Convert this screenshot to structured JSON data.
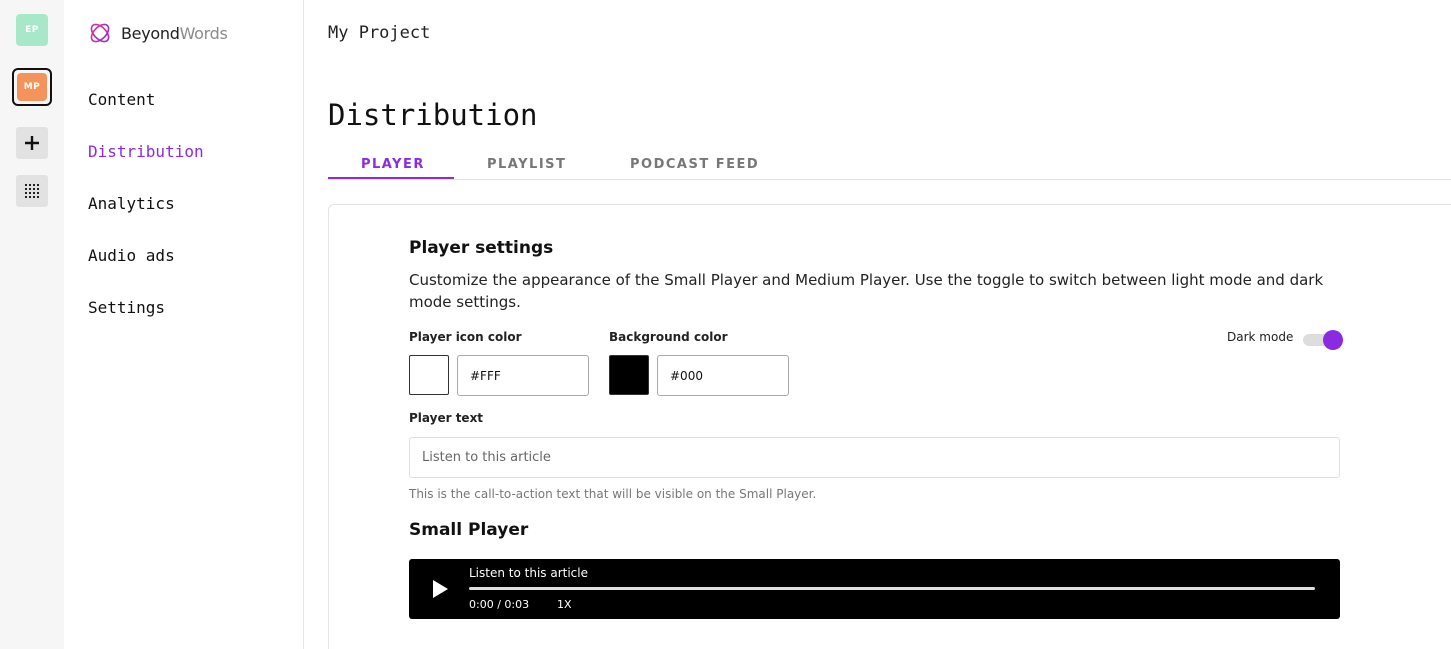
{
  "rail": {
    "workspaces": [
      {
        "initials": "EP",
        "color": "#a8e8c8"
      },
      {
        "initials": "MP",
        "color": "#f4935a",
        "selected": true
      }
    ],
    "add_icon": "plus-icon",
    "apps_icon": "grid-icon"
  },
  "brand": {
    "name_bold": "Beyond",
    "name_light": "Words",
    "logo_icon": "beyondwords-logo-icon"
  },
  "sidebar": {
    "items": [
      {
        "label": "Content"
      },
      {
        "label": "Distribution",
        "active": true
      },
      {
        "label": "Analytics"
      },
      {
        "label": "Audio ads"
      },
      {
        "label": "Settings"
      }
    ]
  },
  "header": {
    "project": "My Project",
    "title": "Distribution"
  },
  "tabs": [
    {
      "label": "PLAYER",
      "active": true
    },
    {
      "label": "PLAYLIST"
    },
    {
      "label": "PODCAST FEED"
    }
  ],
  "settings": {
    "title": "Player settings",
    "description": "Customize the appearance of the Small Player and Medium Player. Use the toggle to switch between light mode and dark mode settings.",
    "icon_color_label": "Player icon color",
    "icon_color_value": "#FFF",
    "background_color_label": "Background color",
    "background_color_value": "#000",
    "dark_mode_label": "Dark mode",
    "dark_mode_on": true,
    "player_text_label": "Player text",
    "player_text_placeholder": "Listen to this article",
    "player_text_helper": "This is the call-to-action text that will be visible on the Small Player.",
    "accent_color": "#8a2be2"
  },
  "small_player": {
    "title": "Small Player",
    "text": "Listen to this article",
    "time": "0:00 / 0:03",
    "speed": "1X",
    "progress": 0
  }
}
